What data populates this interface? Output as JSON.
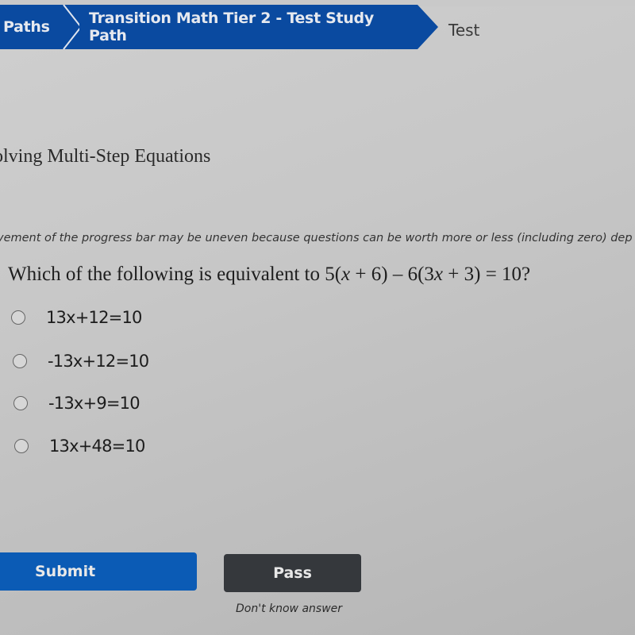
{
  "breadcrumb": {
    "items": [
      {
        "label": "Paths"
      },
      {
        "label": "Transition Math Tier 2 - Test Study Path"
      },
      {
        "label": "Test"
      }
    ]
  },
  "module": {
    "title": "olving Multi-Step Equations"
  },
  "progress_note": "vement of the progress bar may be uneven because questions can be worth more or less (including zero) dep",
  "question": {
    "prefix": "Which of the following is equivalent to ",
    "equation_parts": [
      "5(",
      "x",
      " + 6) – 6(3",
      "x",
      " + 3) = 10?"
    ]
  },
  "options": [
    {
      "label": "13x+12=10",
      "selected": false
    },
    {
      "label": "-13x+12=10",
      "selected": false
    },
    {
      "label": "-13x+9=10",
      "selected": false
    },
    {
      "label": "13x+48=10",
      "selected": false
    }
  ],
  "actions": {
    "submit_label": "Submit",
    "pass_label": "Pass",
    "pass_hint": "Don't know answer"
  },
  "colors": {
    "brand_blue": "#0a4aa0",
    "submit_blue": "#0b5bb5",
    "pass_dark": "#35383c"
  }
}
